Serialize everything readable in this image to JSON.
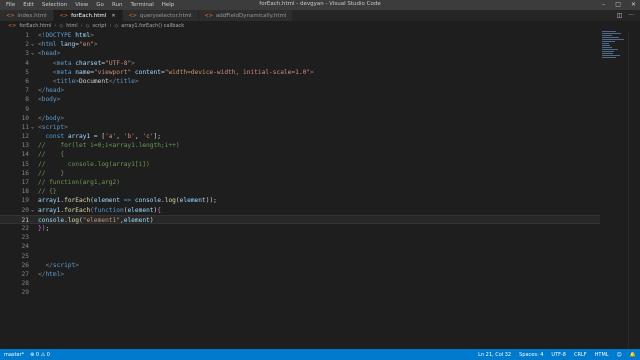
{
  "window": {
    "menu": [
      "File",
      "Edit",
      "Selection",
      "View",
      "Go",
      "Run",
      "Terminal",
      "Help"
    ],
    "title": "forEach.html - devgyan - Visual Studio Code"
  },
  "tabs": [
    {
      "label": "index.html",
      "active": false
    },
    {
      "label": "forEach.html",
      "active": true
    },
    {
      "label": "queryselector.html",
      "active": false
    },
    {
      "label": "addFieldDynamically.html",
      "active": false
    }
  ],
  "breadcrumb": {
    "file": "forEach.html",
    "items": [
      "html",
      "script",
      "array1.forEach() callback"
    ]
  },
  "editor": {
    "current_line": 21,
    "lines": [
      [
        [
          "t-br",
          "<!"
        ],
        [
          "t-tag",
          "DOCTYPE"
        ],
        [
          "t-attr",
          " html"
        ],
        [
          "t-br",
          ">"
        ]
      ],
      [
        [
          "t-br",
          "<"
        ],
        [
          "t-tag",
          "html"
        ],
        [
          "t-attr",
          " lang"
        ],
        [
          "t-p",
          "="
        ],
        [
          "t-str",
          "\"en\""
        ],
        [
          "t-br",
          ">"
        ]
      ],
      [
        [
          "t-br",
          "<"
        ],
        [
          "t-tag",
          "head"
        ],
        [
          "t-br",
          ">"
        ]
      ],
      [
        [
          "t-p",
          "    "
        ],
        [
          "t-br",
          "<"
        ],
        [
          "t-tag",
          "meta"
        ],
        [
          "t-attr",
          " charset"
        ],
        [
          "t-p",
          "="
        ],
        [
          "t-str",
          "\"UTF-8\""
        ],
        [
          "t-br",
          ">"
        ]
      ],
      [
        [
          "t-p",
          "    "
        ],
        [
          "t-br",
          "<"
        ],
        [
          "t-tag",
          "meta"
        ],
        [
          "t-attr",
          " name"
        ],
        [
          "t-p",
          "="
        ],
        [
          "t-str",
          "\"viewport\""
        ],
        [
          "t-attr",
          " content"
        ],
        [
          "t-p",
          "="
        ],
        [
          "t-str",
          "\"width=device-width, initial-scale=1.0\""
        ],
        [
          "t-br",
          ">"
        ]
      ],
      [
        [
          "t-p",
          "    "
        ],
        [
          "t-br",
          "<"
        ],
        [
          "t-tag",
          "title"
        ],
        [
          "t-br",
          ">"
        ],
        [
          "t-txt",
          "Document"
        ],
        [
          "t-br",
          "</"
        ],
        [
          "t-tag",
          "title"
        ],
        [
          "t-br",
          ">"
        ]
      ],
      [
        [
          "t-br",
          "</"
        ],
        [
          "t-tag",
          "head"
        ],
        [
          "t-br",
          ">"
        ]
      ],
      [
        [
          "t-br",
          "<"
        ],
        [
          "t-tag",
          "body"
        ],
        [
          "t-br",
          ">"
        ]
      ],
      [],
      [
        [
          "t-br",
          "</"
        ],
        [
          "t-tag",
          "body"
        ],
        [
          "t-br",
          ">"
        ]
      ],
      [
        [
          "t-br",
          "<"
        ],
        [
          "t-tag",
          "script"
        ],
        [
          "t-br",
          ">"
        ]
      ],
      [
        [
          "t-p",
          "  "
        ],
        [
          "t-kw",
          "const"
        ],
        [
          "t-var",
          " array1"
        ],
        [
          "t-p",
          " = ["
        ],
        [
          "t-str",
          "'a'"
        ],
        [
          "t-p",
          ", "
        ],
        [
          "t-str",
          "'b'"
        ],
        [
          "t-p",
          ", "
        ],
        [
          "t-str",
          "'c'"
        ],
        [
          "t-p",
          "];"
        ]
      ],
      [
        [
          "t-cmt",
          "//    for(let i=0;i<array1.length;i++)"
        ]
      ],
      [
        [
          "t-cmt",
          "//    {"
        ]
      ],
      [
        [
          "t-cmt",
          "//      console.log(array1[i])"
        ]
      ],
      [
        [
          "t-cmt",
          "//    }"
        ]
      ],
      [
        [
          "t-cmt",
          "// function(arg1,arg2)"
        ]
      ],
      [
        [
          "t-cmt",
          "// {}"
        ]
      ],
      [
        [
          "t-var",
          "array1"
        ],
        [
          "t-p",
          "."
        ],
        [
          "t-fn",
          "forEach"
        ],
        [
          "t-p",
          "("
        ],
        [
          "t-var",
          "element"
        ],
        [
          "t-kw",
          " =>"
        ],
        [
          "t-var",
          " console"
        ],
        [
          "t-p",
          "."
        ],
        [
          "t-fn",
          "log"
        ],
        [
          "t-p",
          "("
        ],
        [
          "t-var",
          "element"
        ],
        [
          "t-p",
          "));"
        ]
      ],
      [
        [
          "t-var",
          "array1"
        ],
        [
          "t-p",
          "."
        ],
        [
          "t-fn",
          "forEach"
        ],
        [
          "t-br2",
          "("
        ],
        [
          "t-kw",
          "function"
        ],
        [
          "t-p",
          "("
        ],
        [
          "t-var",
          "element"
        ],
        [
          "t-p",
          ")"
        ],
        [
          "t-br2",
          "{"
        ]
      ],
      [
        [
          "t-var",
          "console"
        ],
        [
          "t-p",
          "."
        ],
        [
          "t-fn",
          "log"
        ],
        [
          "t-p",
          "("
        ],
        [
          "t-str",
          "\"element1\""
        ],
        [
          "t-p",
          ","
        ],
        [
          "t-var",
          "element"
        ],
        [
          "t-p",
          ")"
        ]
      ],
      [
        [
          "t-br2",
          "}"
        ],
        [
          "t-br2",
          ")"
        ],
        [
          "t-p",
          ";"
        ]
      ],
      [],
      [],
      [],
      [
        [
          "t-p",
          "  "
        ],
        [
          "t-br",
          "</"
        ],
        [
          "t-tag",
          "script"
        ],
        [
          "t-br",
          ">"
        ]
      ],
      [
        [
          "t-br",
          "</"
        ],
        [
          "t-tag",
          "html"
        ],
        [
          "t-br",
          ">"
        ]
      ],
      [],
      []
    ]
  },
  "statusbar": {
    "left": [
      "master*",
      "⊗ 0  ⚠ 0"
    ],
    "right": [
      "Ln 21, Col 32",
      "Spaces: 4",
      "UTF-8",
      "CRLF",
      "HTML"
    ]
  },
  "colors": {
    "statusbar": "#007acc",
    "editor_bg": "#1e1e1e",
    "titlebar": "#3c3c3c"
  }
}
